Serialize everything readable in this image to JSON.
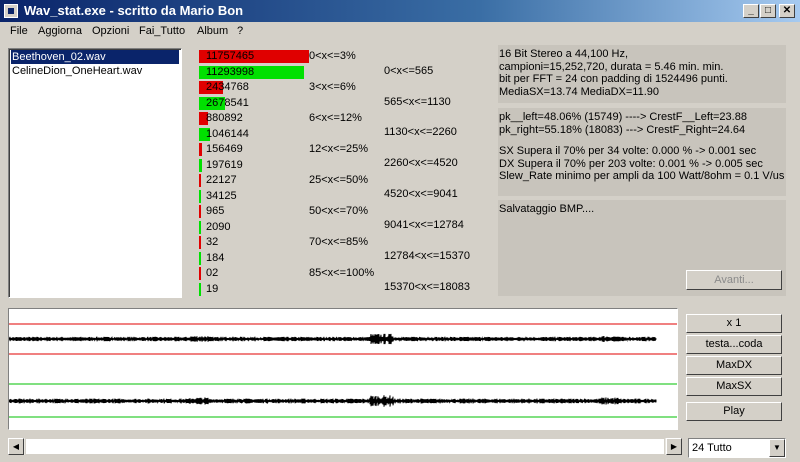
{
  "window": {
    "title": "Wav_stat.exe - scritto da Mario Bon",
    "min_glyph": "_",
    "max_glyph": "□",
    "close_glyph": "✕"
  },
  "menu": [
    "File",
    "Aggiorna",
    "Opzioni",
    "Fai_Tutto",
    "Album",
    "?"
  ],
  "files": [
    {
      "name": "Beethoven_02.wav",
      "selected": true
    },
    {
      "name": "CelineDion_OneHeart.wav",
      "selected": false
    }
  ],
  "amplitude_stats": [
    {
      "value": "11757465",
      "fraction": 0.73,
      "color": "#e00000",
      "label": "0<x<=3%"
    },
    {
      "value": "11293998",
      "fraction": 0.7,
      "color": "#00e000"
    },
    {
      "value": "2434768",
      "fraction": 0.16,
      "color": "#e00000",
      "label": "3<x<=6%"
    },
    {
      "value": "2678541",
      "fraction": 0.17,
      "color": "#00e000"
    },
    {
      "value": "880892",
      "fraction": 0.06,
      "color": "#e00000",
      "label": "6<x<=12%"
    },
    {
      "value": "1046144",
      "fraction": 0.07,
      "color": "#00e000"
    },
    {
      "value": "156469",
      "fraction": 0.02,
      "color": "#e00000",
      "label": "12<x<=25%"
    },
    {
      "value": "197619",
      "fraction": 0.02,
      "color": "#00e000"
    },
    {
      "value": "22127",
      "fraction": 0.004,
      "color": "#e00000",
      "label": "25<x<=50%"
    },
    {
      "value": "34125",
      "fraction": 0.005,
      "color": "#00e000"
    },
    {
      "value": "965",
      "fraction": 0.001,
      "color": "#e00000",
      "label": "50<x<=70%"
    },
    {
      "value": "2090",
      "fraction": 0.001,
      "color": "#00e000"
    },
    {
      "value": "32",
      "fraction": 0.001,
      "color": "#e00000",
      "label": "70<x<=85%"
    },
    {
      "value": "184",
      "fraction": 0.001,
      "color": "#00e000"
    },
    {
      "value": "02",
      "fraction": 0.001,
      "color": "#e00000",
      "label": "85<x<=100%"
    },
    {
      "value": "19",
      "fraction": 0.001,
      "color": "#00e000"
    }
  ],
  "frequency_ranges": [
    "0<x<=565",
    "565<x<=1130",
    "1130<x<=2260",
    "2260<x<=4520",
    "4520<x<=9041",
    "9041<x<=12784",
    "12784<x<=15370",
    "15370<x<=18083"
  ],
  "info": {
    "panel1": [
      "16 Bit Stereo a 44,100 Hz,",
      "campioni=15,252,720, durata = 5.46 min. min.",
      "bit per FFT = 24 con padding di 1524496 punti.",
      "MediaSX=13.74  MediaDX=11.90"
    ],
    "panel2a": [
      "pk__left=48.06% (15749) ----> CrestF__Left=23.88",
      "pk_right=55.18% (18083) ---> CrestF_Right=24.64"
    ],
    "panel2b": [
      "SX Supera il 70% per 34 volte: 0.000 % -> 0.001 sec",
      "DX Supera il 70% per 203 volte: 0.001 %  -> 0.005 sec",
      "Slew_Rate minimo per ampli da 100 Watt/8ohm = 0.1 V/us"
    ],
    "panel3": [
      "Salvataggio BMP...."
    ]
  },
  "buttons": {
    "avanti": "Avanti...",
    "zoom": "x 1",
    "head_tail": "testa...coda",
    "max_dx": "MaxDX",
    "max_sx": "MaxSX",
    "play": "Play"
  },
  "combo": {
    "value": "24 Tutto"
  },
  "colors": {
    "left_channel_guides": "#e00000",
    "right_channel_guides": "#00c000",
    "waveform": "#000000",
    "selection": "#0a246a"
  }
}
